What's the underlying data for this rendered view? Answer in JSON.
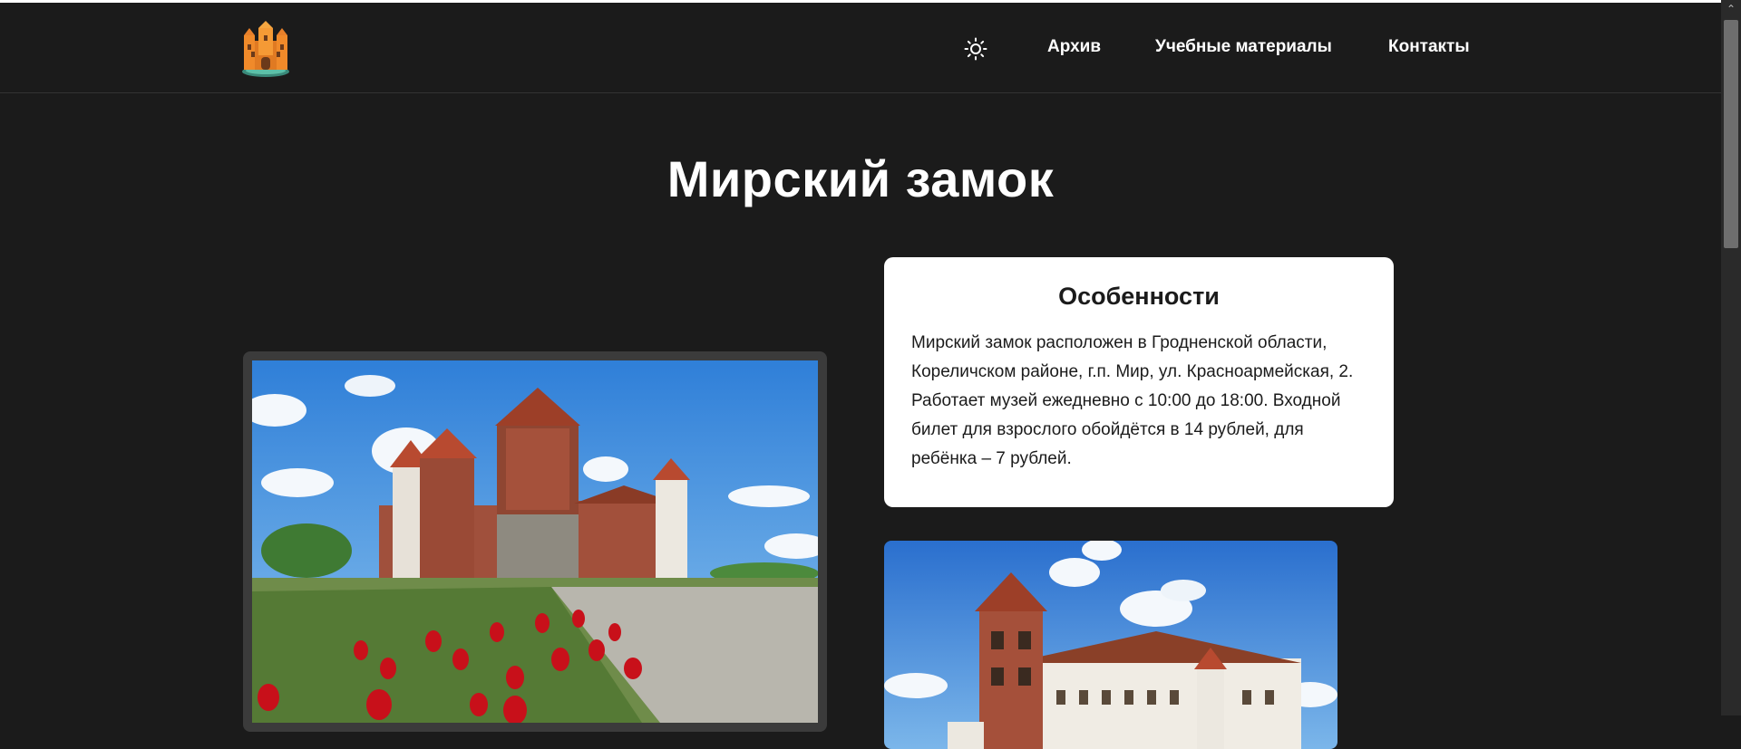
{
  "header": {
    "logo_icon": "castle-logo-icon",
    "theme_icon": "sun-icon",
    "nav": [
      {
        "label": "Архив"
      },
      {
        "label": "Учебные материалы"
      },
      {
        "label": "Контакты"
      }
    ]
  },
  "main": {
    "title": "Мирский замок",
    "info_card": {
      "heading": "Особенности",
      "text": "Мирский замок расположен в Гродненской области, Кореличском районе, г.п. Мир, ул. Красноармейская, 2. Работает музей ежедневно с 10:00 до 18:00. Входной билет для взрослого обойдётся в 14 рублей, для ребёнка – 7 рублей."
    }
  },
  "colors": {
    "background": "#1b1b1b",
    "text": "#ffffff",
    "card": "#ffffff"
  }
}
